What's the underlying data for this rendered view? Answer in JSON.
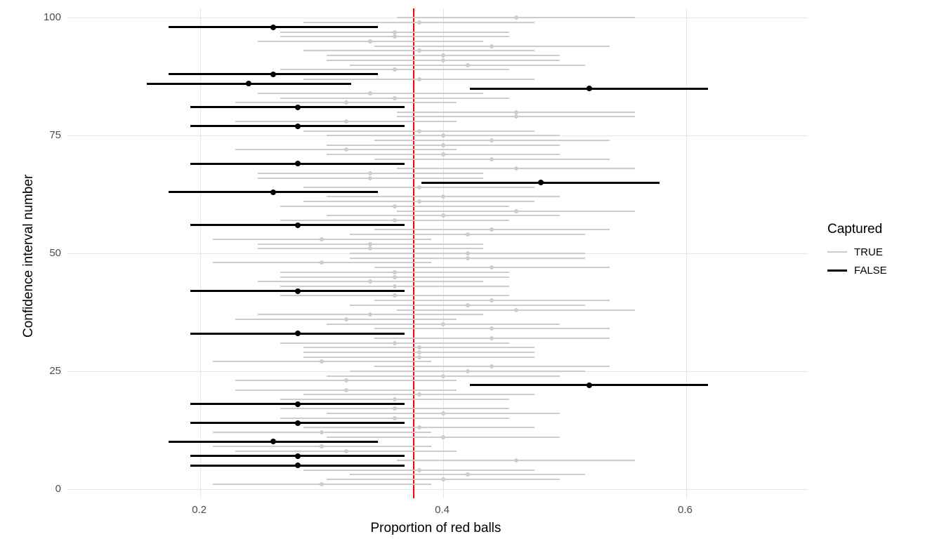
{
  "chart_data": {
    "type": "pointrange",
    "title": "",
    "xlabel": "Proportion of red balls",
    "ylabel": "Confidence interval number",
    "xlim": [
      0.09,
      0.7
    ],
    "ylim": [
      -2,
      102
    ],
    "x_ticks": [
      0.2,
      0.4,
      0.6
    ],
    "y_ticks": [
      0,
      25,
      50,
      75,
      100
    ],
    "reference_line_x": 0.375,
    "legend_title": "Captured",
    "legend_levels": [
      "TRUE",
      "FALSE"
    ],
    "colors": {
      "TRUE": "#cccccc",
      "FALSE": "#000000"
    },
    "intervals": [
      {
        "id": 1,
        "p": 0.3,
        "lo": 0.21,
        "hi": 0.39,
        "captured": true
      },
      {
        "id": 2,
        "p": 0.4,
        "lo": 0.304,
        "hi": 0.496,
        "captured": true
      },
      {
        "id": 3,
        "p": 0.42,
        "lo": 0.323,
        "hi": 0.517,
        "captured": true
      },
      {
        "id": 4,
        "p": 0.38,
        "lo": 0.285,
        "hi": 0.475,
        "captured": true
      },
      {
        "id": 5,
        "p": 0.28,
        "lo": 0.192,
        "hi": 0.368,
        "captured": false
      },
      {
        "id": 6,
        "p": 0.46,
        "lo": 0.362,
        "hi": 0.558,
        "captured": true
      },
      {
        "id": 7,
        "p": 0.28,
        "lo": 0.192,
        "hi": 0.368,
        "captured": false
      },
      {
        "id": 8,
        "p": 0.32,
        "lo": 0.229,
        "hi": 0.411,
        "captured": true
      },
      {
        "id": 9,
        "p": 0.3,
        "lo": 0.21,
        "hi": 0.39,
        "captured": true
      },
      {
        "id": 10,
        "p": 0.26,
        "lo": 0.174,
        "hi": 0.346,
        "captured": false
      },
      {
        "id": 11,
        "p": 0.4,
        "lo": 0.304,
        "hi": 0.496,
        "captured": true
      },
      {
        "id": 12,
        "p": 0.3,
        "lo": 0.21,
        "hi": 0.39,
        "captured": true
      },
      {
        "id": 13,
        "p": 0.38,
        "lo": 0.285,
        "hi": 0.475,
        "captured": true
      },
      {
        "id": 14,
        "p": 0.28,
        "lo": 0.192,
        "hi": 0.368,
        "captured": false
      },
      {
        "id": 15,
        "p": 0.36,
        "lo": 0.266,
        "hi": 0.454,
        "captured": true
      },
      {
        "id": 16,
        "p": 0.4,
        "lo": 0.304,
        "hi": 0.496,
        "captured": true
      },
      {
        "id": 17,
        "p": 0.36,
        "lo": 0.266,
        "hi": 0.454,
        "captured": true
      },
      {
        "id": 18,
        "p": 0.28,
        "lo": 0.192,
        "hi": 0.368,
        "captured": false
      },
      {
        "id": 19,
        "p": 0.36,
        "lo": 0.266,
        "hi": 0.454,
        "captured": true
      },
      {
        "id": 20,
        "p": 0.38,
        "lo": 0.285,
        "hi": 0.475,
        "captured": true
      },
      {
        "id": 21,
        "p": 0.32,
        "lo": 0.229,
        "hi": 0.411,
        "captured": true
      },
      {
        "id": 22,
        "p": 0.52,
        "lo": 0.422,
        "hi": 0.618,
        "captured": false
      },
      {
        "id": 23,
        "p": 0.32,
        "lo": 0.229,
        "hi": 0.411,
        "captured": true
      },
      {
        "id": 24,
        "p": 0.4,
        "lo": 0.304,
        "hi": 0.496,
        "captured": true
      },
      {
        "id": 25,
        "p": 0.42,
        "lo": 0.323,
        "hi": 0.517,
        "captured": true
      },
      {
        "id": 26,
        "p": 0.44,
        "lo": 0.343,
        "hi": 0.537,
        "captured": true
      },
      {
        "id": 27,
        "p": 0.3,
        "lo": 0.21,
        "hi": 0.39,
        "captured": true
      },
      {
        "id": 28,
        "p": 0.38,
        "lo": 0.285,
        "hi": 0.475,
        "captured": true
      },
      {
        "id": 29,
        "p": 0.38,
        "lo": 0.285,
        "hi": 0.475,
        "captured": true
      },
      {
        "id": 30,
        "p": 0.38,
        "lo": 0.285,
        "hi": 0.475,
        "captured": true
      },
      {
        "id": 31,
        "p": 0.36,
        "lo": 0.266,
        "hi": 0.454,
        "captured": true
      },
      {
        "id": 32,
        "p": 0.44,
        "lo": 0.343,
        "hi": 0.537,
        "captured": true
      },
      {
        "id": 33,
        "p": 0.28,
        "lo": 0.192,
        "hi": 0.368,
        "captured": false
      },
      {
        "id": 34,
        "p": 0.44,
        "lo": 0.343,
        "hi": 0.537,
        "captured": true
      },
      {
        "id": 35,
        "p": 0.4,
        "lo": 0.304,
        "hi": 0.496,
        "captured": true
      },
      {
        "id": 36,
        "p": 0.32,
        "lo": 0.229,
        "hi": 0.411,
        "captured": true
      },
      {
        "id": 37,
        "p": 0.34,
        "lo": 0.247,
        "hi": 0.433,
        "captured": true
      },
      {
        "id": 38,
        "p": 0.46,
        "lo": 0.362,
        "hi": 0.558,
        "captured": true
      },
      {
        "id": 39,
        "p": 0.42,
        "lo": 0.323,
        "hi": 0.517,
        "captured": true
      },
      {
        "id": 40,
        "p": 0.44,
        "lo": 0.343,
        "hi": 0.537,
        "captured": true
      },
      {
        "id": 41,
        "p": 0.36,
        "lo": 0.266,
        "hi": 0.454,
        "captured": true
      },
      {
        "id": 42,
        "p": 0.28,
        "lo": 0.192,
        "hi": 0.368,
        "captured": false
      },
      {
        "id": 43,
        "p": 0.36,
        "lo": 0.266,
        "hi": 0.454,
        "captured": true
      },
      {
        "id": 44,
        "p": 0.34,
        "lo": 0.247,
        "hi": 0.433,
        "captured": true
      },
      {
        "id": 45,
        "p": 0.36,
        "lo": 0.266,
        "hi": 0.454,
        "captured": true
      },
      {
        "id": 46,
        "p": 0.36,
        "lo": 0.266,
        "hi": 0.454,
        "captured": true
      },
      {
        "id": 47,
        "p": 0.44,
        "lo": 0.343,
        "hi": 0.537,
        "captured": true
      },
      {
        "id": 48,
        "p": 0.3,
        "lo": 0.21,
        "hi": 0.39,
        "captured": true
      },
      {
        "id": 49,
        "p": 0.42,
        "lo": 0.323,
        "hi": 0.517,
        "captured": true
      },
      {
        "id": 50,
        "p": 0.42,
        "lo": 0.323,
        "hi": 0.517,
        "captured": true
      },
      {
        "id": 51,
        "p": 0.34,
        "lo": 0.247,
        "hi": 0.433,
        "captured": true
      },
      {
        "id": 52,
        "p": 0.34,
        "lo": 0.247,
        "hi": 0.433,
        "captured": true
      },
      {
        "id": 53,
        "p": 0.3,
        "lo": 0.21,
        "hi": 0.39,
        "captured": true
      },
      {
        "id": 54,
        "p": 0.42,
        "lo": 0.323,
        "hi": 0.517,
        "captured": true
      },
      {
        "id": 55,
        "p": 0.44,
        "lo": 0.343,
        "hi": 0.537,
        "captured": true
      },
      {
        "id": 56,
        "p": 0.28,
        "lo": 0.192,
        "hi": 0.368,
        "captured": false
      },
      {
        "id": 57,
        "p": 0.36,
        "lo": 0.266,
        "hi": 0.454,
        "captured": true
      },
      {
        "id": 58,
        "p": 0.4,
        "lo": 0.304,
        "hi": 0.496,
        "captured": true
      },
      {
        "id": 59,
        "p": 0.46,
        "lo": 0.362,
        "hi": 0.558,
        "captured": true
      },
      {
        "id": 60,
        "p": 0.36,
        "lo": 0.266,
        "hi": 0.454,
        "captured": true
      },
      {
        "id": 61,
        "p": 0.38,
        "lo": 0.285,
        "hi": 0.475,
        "captured": true
      },
      {
        "id": 62,
        "p": 0.4,
        "lo": 0.304,
        "hi": 0.496,
        "captured": true
      },
      {
        "id": 63,
        "p": 0.26,
        "lo": 0.174,
        "hi": 0.346,
        "captured": false
      },
      {
        "id": 64,
        "p": 0.38,
        "lo": 0.285,
        "hi": 0.475,
        "captured": true
      },
      {
        "id": 65,
        "p": 0.48,
        "lo": 0.382,
        "hi": 0.578,
        "captured": false
      },
      {
        "id": 66,
        "p": 0.34,
        "lo": 0.247,
        "hi": 0.433,
        "captured": true
      },
      {
        "id": 67,
        "p": 0.34,
        "lo": 0.247,
        "hi": 0.433,
        "captured": true
      },
      {
        "id": 68,
        "p": 0.46,
        "lo": 0.362,
        "hi": 0.558,
        "captured": true
      },
      {
        "id": 69,
        "p": 0.28,
        "lo": 0.192,
        "hi": 0.368,
        "captured": false
      },
      {
        "id": 70,
        "p": 0.44,
        "lo": 0.343,
        "hi": 0.537,
        "captured": true
      },
      {
        "id": 71,
        "p": 0.4,
        "lo": 0.304,
        "hi": 0.496,
        "captured": true
      },
      {
        "id": 72,
        "p": 0.32,
        "lo": 0.229,
        "hi": 0.411,
        "captured": true
      },
      {
        "id": 73,
        "p": 0.4,
        "lo": 0.304,
        "hi": 0.496,
        "captured": true
      },
      {
        "id": 74,
        "p": 0.44,
        "lo": 0.343,
        "hi": 0.537,
        "captured": true
      },
      {
        "id": 75,
        "p": 0.4,
        "lo": 0.304,
        "hi": 0.496,
        "captured": true
      },
      {
        "id": 76,
        "p": 0.38,
        "lo": 0.285,
        "hi": 0.475,
        "captured": true
      },
      {
        "id": 77,
        "p": 0.28,
        "lo": 0.192,
        "hi": 0.368,
        "captured": false
      },
      {
        "id": 78,
        "p": 0.32,
        "lo": 0.229,
        "hi": 0.411,
        "captured": true
      },
      {
        "id": 79,
        "p": 0.46,
        "lo": 0.362,
        "hi": 0.558,
        "captured": true
      },
      {
        "id": 80,
        "p": 0.46,
        "lo": 0.362,
        "hi": 0.558,
        "captured": true
      },
      {
        "id": 81,
        "p": 0.28,
        "lo": 0.192,
        "hi": 0.368,
        "captured": false
      },
      {
        "id": 82,
        "p": 0.32,
        "lo": 0.229,
        "hi": 0.411,
        "captured": true
      },
      {
        "id": 83,
        "p": 0.36,
        "lo": 0.266,
        "hi": 0.454,
        "captured": true
      },
      {
        "id": 84,
        "p": 0.34,
        "lo": 0.247,
        "hi": 0.433,
        "captured": true
      },
      {
        "id": 85,
        "p": 0.52,
        "lo": 0.422,
        "hi": 0.618,
        "captured": false
      },
      {
        "id": 86,
        "p": 0.24,
        "lo": 0.156,
        "hi": 0.324,
        "captured": false
      },
      {
        "id": 87,
        "p": 0.38,
        "lo": 0.285,
        "hi": 0.475,
        "captured": true
      },
      {
        "id": 88,
        "p": 0.26,
        "lo": 0.174,
        "hi": 0.346,
        "captured": false
      },
      {
        "id": 89,
        "p": 0.36,
        "lo": 0.266,
        "hi": 0.454,
        "captured": true
      },
      {
        "id": 90,
        "p": 0.42,
        "lo": 0.323,
        "hi": 0.517,
        "captured": true
      },
      {
        "id": 91,
        "p": 0.4,
        "lo": 0.304,
        "hi": 0.496,
        "captured": true
      },
      {
        "id": 92,
        "p": 0.4,
        "lo": 0.304,
        "hi": 0.496,
        "captured": true
      },
      {
        "id": 93,
        "p": 0.38,
        "lo": 0.285,
        "hi": 0.475,
        "captured": true
      },
      {
        "id": 94,
        "p": 0.44,
        "lo": 0.343,
        "hi": 0.537,
        "captured": true
      },
      {
        "id": 95,
        "p": 0.34,
        "lo": 0.247,
        "hi": 0.433,
        "captured": true
      },
      {
        "id": 96,
        "p": 0.36,
        "lo": 0.266,
        "hi": 0.454,
        "captured": true
      },
      {
        "id": 97,
        "p": 0.36,
        "lo": 0.266,
        "hi": 0.454,
        "captured": true
      },
      {
        "id": 98,
        "p": 0.26,
        "lo": 0.174,
        "hi": 0.346,
        "captured": false
      },
      {
        "id": 99,
        "p": 0.38,
        "lo": 0.285,
        "hi": 0.475,
        "captured": true
      },
      {
        "id": 100,
        "p": 0.46,
        "lo": 0.362,
        "hi": 0.558,
        "captured": true
      }
    ]
  }
}
